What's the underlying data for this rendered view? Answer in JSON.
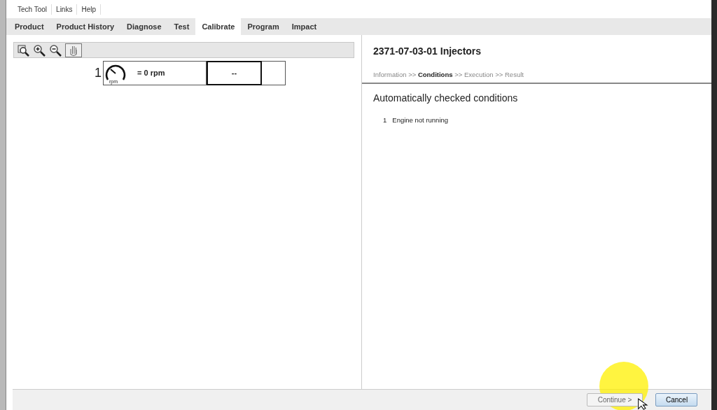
{
  "menu": [
    "Tech Tool",
    "Links",
    "Help"
  ],
  "tabs": [
    {
      "label": "Product",
      "selected": false
    },
    {
      "label": "Product History",
      "selected": false
    },
    {
      "label": "Diagnose",
      "selected": false
    },
    {
      "label": "Test",
      "selected": false
    },
    {
      "label": "Calibrate",
      "selected": true
    },
    {
      "label": "Program",
      "selected": false
    },
    {
      "label": "Impact",
      "selected": false
    }
  ],
  "gauge_row": {
    "index": "1",
    "unit": "rpm",
    "reading": "= 0 rpm",
    "value": "--"
  },
  "panel": {
    "title": "2371-07-03-01 Injectors",
    "steps": [
      {
        "label": "Information",
        "selected": false
      },
      {
        "label": "Conditions",
        "selected": true
      },
      {
        "label": "Execution",
        "selected": false
      },
      {
        "label": "Result",
        "selected": false
      }
    ],
    "separator": ">>",
    "heading": "Automatically checked conditions",
    "conditions": [
      {
        "number": "1",
        "text": "Engine not running"
      }
    ]
  },
  "buttons": [
    {
      "label": "Continue >",
      "disabled": true
    },
    {
      "label": "Cancel",
      "disabled": false
    }
  ]
}
